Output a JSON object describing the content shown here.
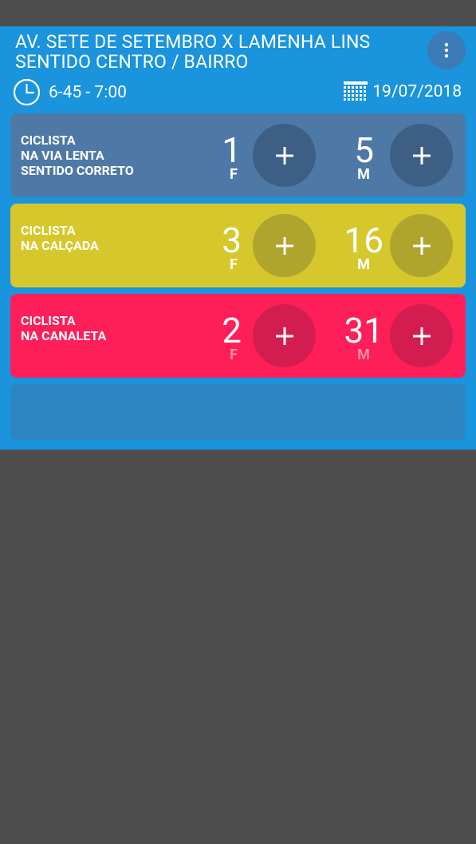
{
  "header": {
    "title": "AV. SETE DE SETEMBRO X LAMENHA LINS\nSENTIDO CENTRO / BAIRRO",
    "time_range": "6-45 - 7:00",
    "date": "19/07/2018",
    "menu_icon": "more-vert-icon",
    "clock_icon": "clock-icon",
    "calendar_icon": "calendar-icon"
  },
  "colors": {
    "panel": "#1a94dd",
    "card_via_lenta": "#4e79a6",
    "card_calcada": "#d6c82c",
    "card_canaleta": "#ff1f58",
    "empty_card": "#2d86c1",
    "background": "#4e4e4e"
  },
  "cards": [
    {
      "label": "CICLISTA\nNA VIA LENTA\nSENTIDO CORRETO",
      "female_count": "1",
      "female_label": "F",
      "male_count": "5",
      "male_label": "M"
    },
    {
      "label": "CICLISTA\nNA CALÇADA",
      "female_count": "3",
      "female_label": "F",
      "male_count": "16",
      "male_label": "M"
    },
    {
      "label": "CICLISTA\nNA CANALETA",
      "female_count": "2",
      "female_label": "F",
      "male_count": "31",
      "male_label": "M"
    }
  ],
  "plus_label": "+"
}
